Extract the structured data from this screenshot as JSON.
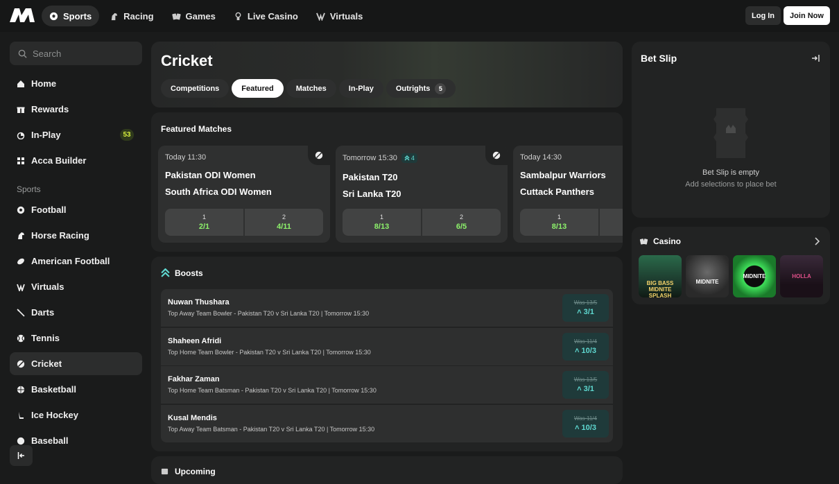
{
  "topbar": {
    "nav": [
      {
        "label": "Sports",
        "icon": "football-icon"
      },
      {
        "label": "Racing",
        "icon": "horse-icon"
      },
      {
        "label": "Games",
        "icon": "cards-icon"
      },
      {
        "label": "Live Casino",
        "icon": "dealer-icon"
      },
      {
        "label": "Virtuals",
        "icon": "virtuals-icon"
      }
    ],
    "login_label": "Log In",
    "join_label": "Join Now"
  },
  "sidebar": {
    "search_placeholder": "Search",
    "main_items": [
      {
        "label": "Home",
        "icon": "home-icon"
      },
      {
        "label": "Rewards",
        "icon": "gift-icon"
      },
      {
        "label": "In-Play",
        "icon": "stopwatch-icon",
        "badge": "53"
      },
      {
        "label": "Acca Builder",
        "icon": "grid-icon"
      }
    ],
    "sports_heading": "Sports",
    "sports": [
      {
        "label": "Football"
      },
      {
        "label": "Horse Racing"
      },
      {
        "label": "American Football"
      },
      {
        "label": "Virtuals"
      },
      {
        "label": "Darts"
      },
      {
        "label": "Tennis"
      },
      {
        "label": "Cricket"
      },
      {
        "label": "Basketball"
      },
      {
        "label": "Ice Hockey"
      },
      {
        "label": "Baseball"
      }
    ]
  },
  "hero": {
    "title": "Cricket",
    "tabs": [
      {
        "label": "Competitions"
      },
      {
        "label": "Featured"
      },
      {
        "label": "Matches"
      },
      {
        "label": "In-Play"
      },
      {
        "label": "Outrights",
        "count": "5"
      }
    ]
  },
  "featured": {
    "title": "Featured Matches",
    "matches": [
      {
        "time": "Today 11:30",
        "boost": "",
        "team1": "Pakistan ODI Women",
        "team2": "South Africa ODI Women",
        "odds": [
          {
            "label": "1",
            "value": "2/1"
          },
          {
            "label": "2",
            "value": "4/11"
          }
        ]
      },
      {
        "time": "Tomorrow 15:30",
        "boost": "4",
        "team1": "Pakistan T20",
        "team2": "Sri Lanka T20",
        "odds": [
          {
            "label": "1",
            "value": "8/13"
          },
          {
            "label": "2",
            "value": "6/5"
          }
        ]
      },
      {
        "time": "Today 14:30",
        "boost": "",
        "team1": "Sambalpur Warriors",
        "team2": "Cuttack Panthers",
        "odds": [
          {
            "label": "1",
            "value": "8/13"
          }
        ]
      }
    ]
  },
  "boosts": {
    "title": "Boosts",
    "items": [
      {
        "name": "Nuwan Thushara",
        "desc": "Top Away Team Bowler - Pakistan T20 v Sri Lanka T20 | Tomorrow 15:30",
        "was": "Was 13/5",
        "now": "3/1"
      },
      {
        "name": "Shaheen Afridi",
        "desc": "Top Home Team Bowler - Pakistan T20 v Sri Lanka T20 | Tomorrow 15:30",
        "was": "Was 11/4",
        "now": "10/3"
      },
      {
        "name": "Fakhar Zaman",
        "desc": "Top Home Team Batsman - Pakistan T20 v Sri Lanka T20 | Tomorrow 15:30",
        "was": "Was 13/5",
        "now": "3/1"
      },
      {
        "name": "Kusal Mendis",
        "desc": "Top Away Team Batsman - Pakistan T20 v Sri Lanka T20 | Tomorrow 15:30",
        "was": "Was 11/4",
        "now": "10/3"
      }
    ]
  },
  "upcoming": {
    "title": "Upcoming"
  },
  "betslip": {
    "title": "Bet Slip",
    "empty_title": "Bet Slip is empty",
    "empty_sub": "Add selections to place bet"
  },
  "casino": {
    "title": "Casino",
    "games": [
      {
        "label": "BIG BASS MIDNITE SPLASH"
      },
      {
        "label": "MIDNITE"
      },
      {
        "label": "MIDNITE"
      },
      {
        "label": "HOLLA"
      }
    ]
  },
  "colors": {
    "background": "#1a1b1b",
    "odds_green": "#8df36b",
    "boost_teal": "#5fd9d1",
    "badge_yellow": "#d6ef3d"
  }
}
